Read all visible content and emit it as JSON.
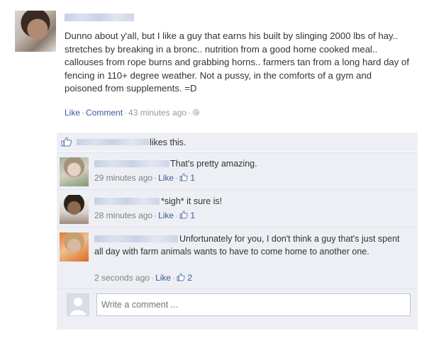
{
  "post": {
    "author_name": "",
    "text": "Dunno about y'all, but I like a guy that earns his built by slinging 2000 lbs of hay.. stretches by breaking in a bronc.. nutrition from a good home cooked meal.. callouses from rope burns and grabbing horns.. farmers tan from a long hard day of fencing in 110+ degree weather. Not a pussy, in the comforts of a gym and poisoned from supplements. =D",
    "like_label": "Like",
    "comment_label": "Comment",
    "timestamp": "43 minutes ago",
    "privacy_icon": "globe-icon"
  },
  "likes": {
    "text": "likes this.",
    "icon": "thumbs-up-icon"
  },
  "comments": [
    {
      "text": "That's pretty amazing.",
      "timestamp": "29 minutes ago",
      "like_label": "Like",
      "like_count": "1"
    },
    {
      "text": "*sigh* it sure is!",
      "timestamp": "28 minutes ago",
      "like_label": "Like",
      "like_count": "1"
    },
    {
      "text": "Unfortunately for you, I don't think a guy that's just spent all day with farm animals wants to have to come home to another one.",
      "timestamp": "2 seconds ago",
      "like_label": "Like",
      "like_count": "2"
    }
  ],
  "composer": {
    "placeholder": "Write a comment ..."
  },
  "colors": {
    "link": "#3b5998",
    "panel": "#edeff4",
    "meta": "#999999"
  }
}
